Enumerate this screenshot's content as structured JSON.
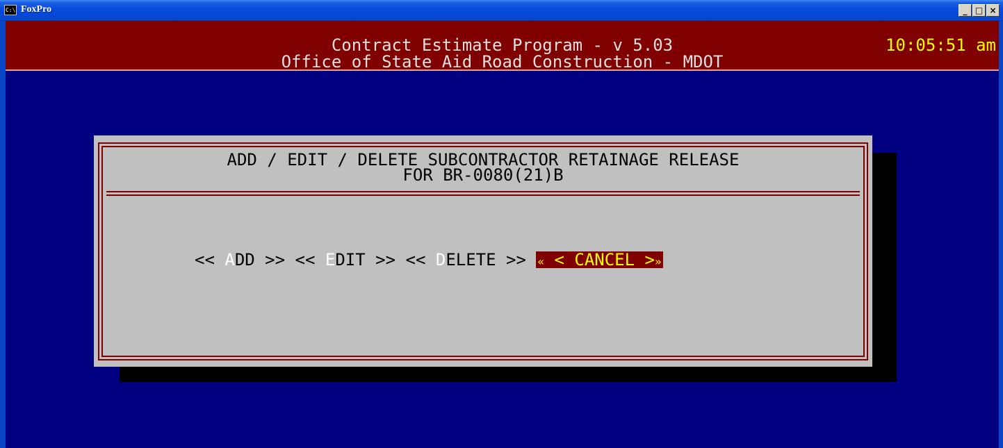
{
  "window": {
    "title": "FoxPro",
    "icon": "console-icon",
    "icon_text": "C:\\",
    "controls": {
      "minimize": "_",
      "maximize": "□",
      "close": "×"
    }
  },
  "header": {
    "line1": "Contract Estimate Program - v 5.03",
    "line2": "Office of State Aid Road Construction - MDOT",
    "clock": "10:05:51 am"
  },
  "dialog": {
    "heading1": "ADD / EDIT / DELETE SUBCONTRACTOR RETAINAGE RELEASE",
    "heading2": "FOR BR-0080(21)B",
    "buttons": {
      "add": {
        "open": "<< ",
        "hotkey": "A",
        "rest": "DD",
        "close": " >>"
      },
      "edit": {
        "open": "<< ",
        "hotkey": "E",
        "rest": "DIT",
        "close": " >>"
      },
      "delete": {
        "open": "<< ",
        "hotkey": "D",
        "rest": "ELETE",
        "close": " >>"
      },
      "cancel": {
        "left": "«",
        "label": " < CANCEL >",
        "right": "»"
      }
    }
  },
  "colors": {
    "desktop": "#000080",
    "header_bg": "#800000",
    "clock": "#ffff00",
    "dialog_bg": "#c0c0c0",
    "dialog_border": "#800000",
    "cancel_bg": "#800000",
    "cancel_text": "#ffff00"
  }
}
